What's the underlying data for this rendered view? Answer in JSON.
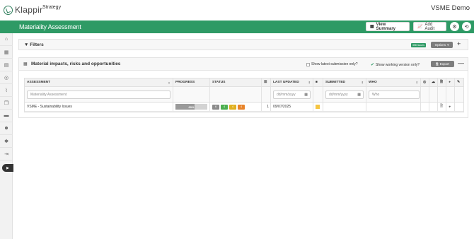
{
  "header": {
    "logo_text": "Klappir",
    "module": "Strategy",
    "org": "VSME Demo"
  },
  "page": {
    "title": "Materiality Assessment",
    "view_summary_label": "View Summary",
    "add_audit_label": "Add Audit"
  },
  "filters": {
    "title": "Filters",
    "issues_badge": "358 Issues",
    "options_label": "Options",
    "options_caret": "▾",
    "plus": "+"
  },
  "panel": {
    "title": "Material impacts, risks and opportunities",
    "latest_label": "Show latest submission only?",
    "working_label": "Show working version only?",
    "export_label": "Export",
    "minus": "—"
  },
  "table": {
    "headers": {
      "assessment": "ASSESSMENT",
      "progress": "PROGRESS",
      "status": "STATUS",
      "last_updated": "LAST UPDATED",
      "submitted": "SUBMITTED",
      "who": "WHO"
    },
    "filter_placeholders": {
      "assessment": "Materiality Assessment",
      "last_updated": "dd/mm/yyyy",
      "submitted": "dd/mm/yyyy",
      "who": "Who"
    },
    "rows": [
      {
        "assessment": "VSME - Sustainability Issues",
        "progress_label": "60%",
        "progress": 0.6,
        "status_counts": [
          "6",
          "4",
          "4",
          "4"
        ],
        "count": "1",
        "last_updated": "09/07/2025"
      }
    ]
  },
  "colors": {
    "brand_green": "#2e9a65",
    "status": [
      "#8c8c8c",
      "#4caf50",
      "#e0b020",
      "#e8842a"
    ]
  }
}
